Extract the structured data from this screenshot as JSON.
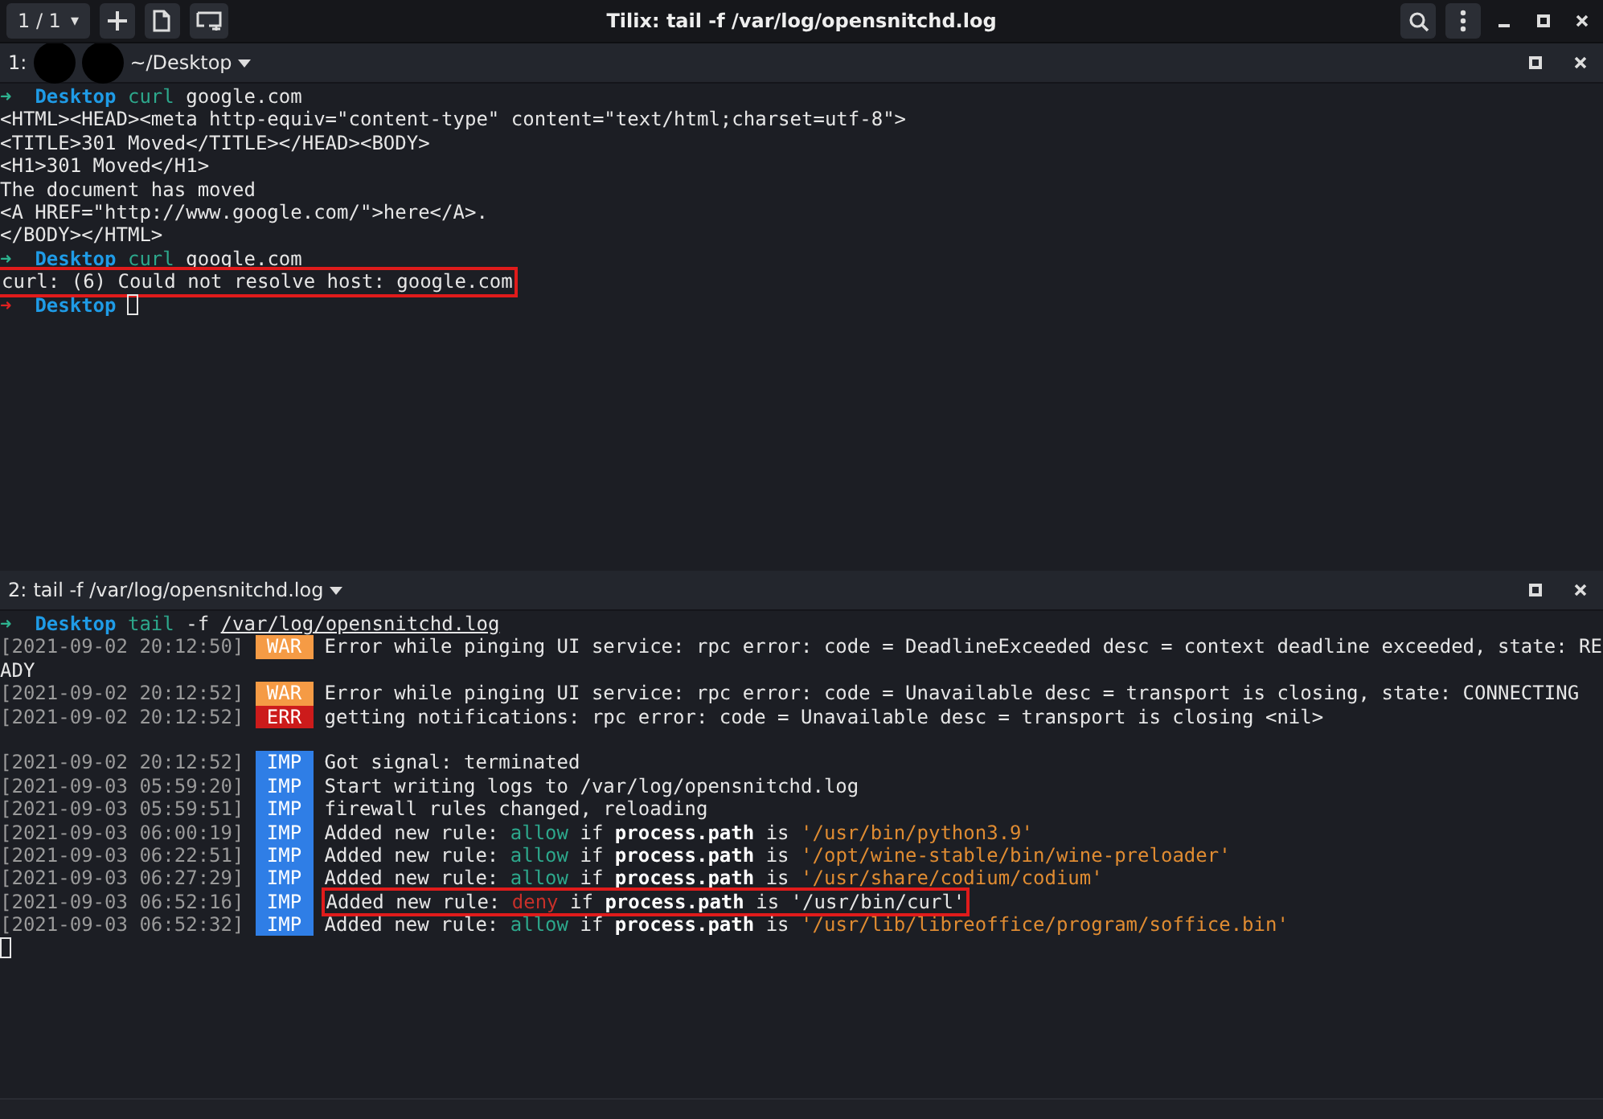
{
  "window": {
    "title": "Tilix: tail -f /var/log/opensnitchd.log",
    "session": "1 / 1",
    "session_caret": "▾"
  },
  "panes": [
    {
      "number": "1:",
      "redacted": true,
      "title": "~/Desktop",
      "lines": [
        {
          "kind": "text",
          "highlighted": false,
          "segments": [
            {
              "kind": "arrow",
              "failed": false,
              "text": "➜  "
            },
            {
              "kind": "dir",
              "text": "Desktop "
            },
            {
              "kind": "cmd",
              "text": "curl"
            },
            {
              "kind": "plain",
              "text": " google.com"
            }
          ]
        },
        {
          "kind": "text",
          "highlighted": false,
          "segments": [
            {
              "kind": "plain",
              "text": "<HTML><HEAD><meta http-equiv=\"content-type\" content=\"text/html;charset=utf-8\">"
            }
          ]
        },
        {
          "kind": "text",
          "highlighted": false,
          "segments": [
            {
              "kind": "plain",
              "text": "<TITLE>301 Moved</TITLE></HEAD><BODY>"
            }
          ]
        },
        {
          "kind": "text",
          "highlighted": false,
          "segments": [
            {
              "kind": "plain",
              "text": "<H1>301 Moved</H1>"
            }
          ]
        },
        {
          "kind": "text",
          "highlighted": false,
          "segments": [
            {
              "kind": "plain",
              "text": "The document has moved"
            }
          ]
        },
        {
          "kind": "text",
          "highlighted": false,
          "segments": [
            {
              "kind": "plain",
              "text": "<A HREF=\"http://www.google.com/\">here</A>."
            }
          ]
        },
        {
          "kind": "text",
          "highlighted": false,
          "segments": [
            {
              "kind": "plain",
              "text": "</BODY></HTML>"
            }
          ]
        },
        {
          "kind": "text",
          "highlighted": false,
          "segments": [
            {
              "kind": "arrow",
              "failed": false,
              "text": "➜  "
            },
            {
              "kind": "dir",
              "text": "Desktop "
            },
            {
              "kind": "cmd",
              "text": "curl"
            },
            {
              "kind": "plain",
              "text": " google.com"
            }
          ]
        },
        {
          "kind": "text",
          "highlighted": true,
          "segments": [
            {
              "kind": "plain",
              "text": "curl: (6) Could not resolve host: google.com"
            }
          ]
        },
        {
          "kind": "text",
          "highlighted": false,
          "cursor": true,
          "segments": [
            {
              "kind": "arrow",
              "failed": true,
              "text": "➜  "
            },
            {
              "kind": "dir",
              "text": "Desktop "
            }
          ]
        }
      ]
    },
    {
      "number": "2:",
      "title": "tail -f /var/log/opensnitchd.log",
      "lines": [
        {
          "kind": "text",
          "highlighted": false,
          "segments": [
            {
              "kind": "arrow",
              "failed": false,
              "text": "➜  "
            },
            {
              "kind": "dir",
              "text": "Desktop "
            },
            {
              "kind": "cmd",
              "text": "tail"
            },
            {
              "kind": "plain",
              "text": " -f "
            },
            {
              "kind": "underline",
              "text": "/var/log/opensnitchd.log"
            }
          ]
        },
        {
          "kind": "log",
          "time": "[2021-09-02 20:12:50]",
          "level": "WAR",
          "highlighted": false,
          "segments": [
            {
              "kind": "plain",
              "text": "Error while pinging UI service: rpc error: code = DeadlineExceeded desc = context deadline exceeded, state: RE"
            }
          ]
        },
        {
          "kind": "text",
          "highlighted": false,
          "segments": [
            {
              "kind": "plain",
              "text": "ADY"
            }
          ]
        },
        {
          "kind": "log",
          "time": "[2021-09-02 20:12:52]",
          "level": "WAR",
          "highlighted": false,
          "segments": [
            {
              "kind": "plain",
              "text": "Error while pinging UI service: rpc error: code = Unavailable desc = transport is closing, state: CONNECTING"
            }
          ]
        },
        {
          "kind": "log",
          "time": "[2021-09-02 20:12:52]",
          "level": "ERR",
          "highlighted": false,
          "segments": [
            {
              "kind": "plain",
              "text": "getting notifications: rpc error: code = Unavailable desc = transport is closing <nil>"
            }
          ]
        },
        {
          "kind": "blank"
        },
        {
          "kind": "log",
          "time": "[2021-09-02 20:12:52]",
          "level": "IMP",
          "highlighted": false,
          "segments": [
            {
              "kind": "plain",
              "text": "Got signal: terminated"
            }
          ]
        },
        {
          "kind": "log",
          "time": "[2021-09-03 05:59:20]",
          "level": "IMP",
          "highlighted": false,
          "segments": [
            {
              "kind": "plain",
              "text": "Start writing logs to /var/log/opensnitchd.log"
            }
          ]
        },
        {
          "kind": "log",
          "time": "[2021-09-03 05:59:51]",
          "level": "IMP",
          "highlighted": false,
          "segments": [
            {
              "kind": "plain",
              "text": "firewall rules changed, reloading"
            }
          ]
        },
        {
          "kind": "log",
          "time": "[2021-09-03 06:00:19]",
          "level": "IMP",
          "highlighted": false,
          "segments": [
            {
              "kind": "plain",
              "text": "Added new rule: "
            },
            {
              "kind": "allow",
              "text": "allow"
            },
            {
              "kind": "plain",
              "text": " if "
            },
            {
              "kind": "bold",
              "text": "process.path"
            },
            {
              "kind": "plain",
              "text": " is "
            },
            {
              "kind": "path",
              "text": "'/usr/bin/python3.9'"
            }
          ]
        },
        {
          "kind": "log",
          "time": "[2021-09-03 06:22:51]",
          "level": "IMP",
          "highlighted": false,
          "segments": [
            {
              "kind": "plain",
              "text": "Added new rule: "
            },
            {
              "kind": "allow",
              "text": "allow"
            },
            {
              "kind": "plain",
              "text": " if "
            },
            {
              "kind": "bold",
              "text": "process.path"
            },
            {
              "kind": "plain",
              "text": " is "
            },
            {
              "kind": "path",
              "text": "'/opt/wine-stable/bin/wine-preloader'"
            }
          ]
        },
        {
          "kind": "log",
          "time": "[2021-09-03 06:27:29]",
          "level": "IMP",
          "highlighted": false,
          "segments": [
            {
              "kind": "plain",
              "text": "Added new rule: "
            },
            {
              "kind": "allow",
              "text": "allow"
            },
            {
              "kind": "plain",
              "text": " if "
            },
            {
              "kind": "bold",
              "text": "process.path"
            },
            {
              "kind": "plain",
              "text": " is "
            },
            {
              "kind": "path",
              "text": "'/usr/share/codium/codium'"
            }
          ]
        },
        {
          "kind": "log",
          "time": "[2021-09-03 06:52:16]",
          "level": "IMP",
          "highlighted": true,
          "segments": [
            {
              "kind": "plain",
              "text": "Added new rule: "
            },
            {
              "kind": "deny",
              "text": "deny"
            },
            {
              "kind": "plain",
              "text": " if "
            },
            {
              "kind": "bold",
              "text": "process.path"
            },
            {
              "kind": "plain",
              "text": " is '/usr/bin/curl'"
            }
          ]
        },
        {
          "kind": "log",
          "time": "[2021-09-03 06:52:32]",
          "level": "IMP",
          "highlighted": false,
          "segments": [
            {
              "kind": "plain",
              "text": "Added new rule: "
            },
            {
              "kind": "allow",
              "text": "allow"
            },
            {
              "kind": "plain",
              "text": " if "
            },
            {
              "kind": "bold",
              "text": "process.path"
            },
            {
              "kind": "plain",
              "text": " is "
            },
            {
              "kind": "path",
              "text": "'/usr/lib/libreoffice/program/soffice.bin'"
            }
          ]
        },
        {
          "kind": "text",
          "cursor": true
        }
      ]
    }
  ]
}
